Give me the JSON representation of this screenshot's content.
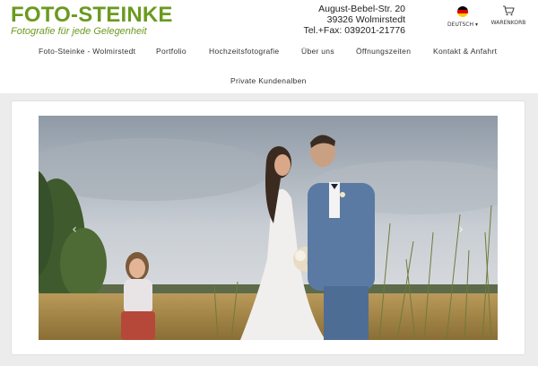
{
  "logo": {
    "title": "FOTO-STEINKE",
    "tagline": "Fotografie für jede Gelegenheit"
  },
  "address": {
    "street": "August-Bebel-Str. 20",
    "city": "39326 Wolmirstedt",
    "phone": "Tel.+Fax: 039201-21776"
  },
  "language": {
    "label": "DEUTSCH",
    "icon": "flag-germany-icon"
  },
  "cart": {
    "label": "WARENKORB",
    "icon": "shopping-cart-icon"
  },
  "nav": {
    "items": [
      "Foto-Steinke - Wolmirstedt",
      "Portfolio",
      "Hochzeitsfotografie",
      "Über uns",
      "Öffnungszeiten",
      "Kontakt & Anfahrt",
      "Private Kundenalben"
    ]
  },
  "slider": {
    "prev_icon": "chevron-left-icon",
    "next_icon": "chevron-right-icon"
  },
  "colors": {
    "brand": "#6b9a1f",
    "page_bg": "#ececec"
  }
}
